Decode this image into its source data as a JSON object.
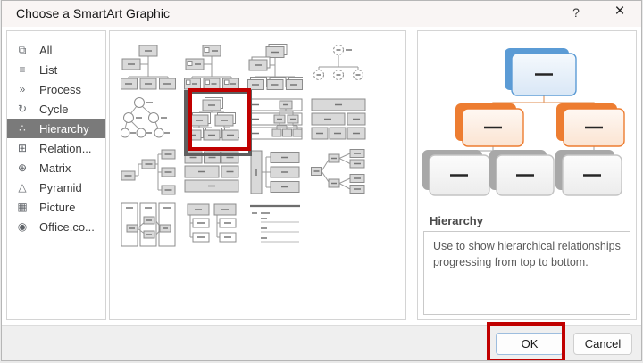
{
  "window": {
    "title": "Choose a SmartArt Graphic",
    "help_glyph": "?",
    "close_glyph": "×"
  },
  "sidebar": {
    "selected_index": 4,
    "items": [
      {
        "icon": "⧉",
        "label": "All"
      },
      {
        "icon": "≡",
        "label": "List"
      },
      {
        "icon": "»",
        "label": "Process"
      },
      {
        "icon": "↻",
        "label": "Cycle"
      },
      {
        "icon": "∴",
        "label": "Hierarchy"
      },
      {
        "icon": "⊞",
        "label": "Relation..."
      },
      {
        "icon": "⊕",
        "label": "Matrix"
      },
      {
        "icon": "△",
        "label": "Pyramid"
      },
      {
        "icon": "▦",
        "label": "Picture"
      },
      {
        "icon": "◉",
        "label": "Office.co..."
      }
    ]
  },
  "gallery": {
    "thumbnail_count": 15,
    "selected_index": 5
  },
  "preview": {
    "heading": "Hierarchy",
    "description": "Use to show hierarchical relationships progressing from top to bottom."
  },
  "footer": {
    "ok_label": "OK",
    "cancel_label": "Cancel"
  },
  "colors": {
    "accent_blue": "#5b9bd5",
    "accent_orange": "#ed7d31",
    "accent_gray": "#a8a8a8",
    "annotation_red": "#c00000",
    "selection_gray": "#7a7a7a"
  }
}
